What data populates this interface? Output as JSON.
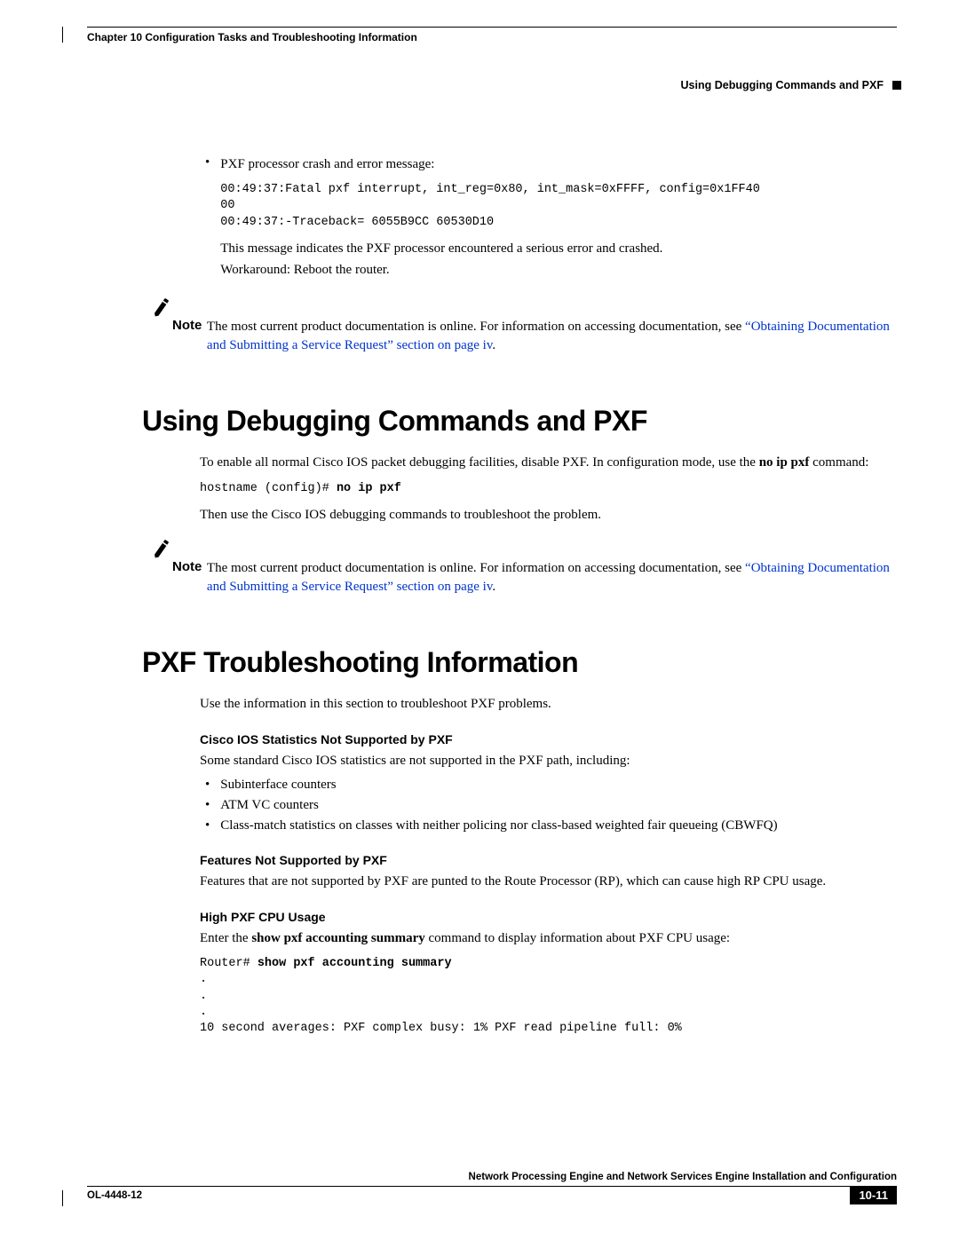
{
  "header": {
    "chapter": "Chapter 10    Configuration Tasks and Troubleshooting Information",
    "section": "Using Debugging Commands and PXF"
  },
  "bullet1": {
    "text": "PXF processor crash and error message:",
    "code": "00:49:37:Fatal pxf interrupt, int_reg=0x80, int_mask=0xFFFF, config=0x1FF40\n00\n00:49:37:-Traceback= 6055B9CC 60530D10",
    "after1": "This message indicates the PXF processor encountered a serious error and crashed.",
    "after2": "Workaround: Reboot the router."
  },
  "note_label": "Note",
  "note1": {
    "text": "The most current product documentation is online. For information on accessing documentation, see ",
    "link": "“Obtaining Documentation and Submitting a Service Request” section on page iv",
    "tail": "."
  },
  "h1a": "Using Debugging Commands and PXF",
  "sec1": {
    "p1a": "To enable all normal Cisco IOS packet debugging facilities, disable PXF. In configuration mode, use the ",
    "p1b": "no ip pxf",
    "p1c": " command:",
    "code_prefix": "hostname (config)# ",
    "code_cmd": "no ip pxf",
    "p2": "Then use the Cisco IOS debugging commands to troubleshoot the problem."
  },
  "note2": {
    "text": "The most current product documentation is online. For information on accessing documentation, see ",
    "link": "“Obtaining Documentation and Submitting a Service Request” section on page iv",
    "tail": "."
  },
  "h1b": "PXF Troubleshooting Information",
  "sec2": {
    "intro": "Use the information in this section to troubleshoot PXF problems.",
    "sub1": "Cisco IOS Statistics Not Supported by PXF",
    "sub1_p": "Some standard Cisco IOS statistics are not supported in the PXF path, including:",
    "li1": "Subinterface counters",
    "li2": "ATM VC counters",
    "li3": "Class-match statistics on classes with neither policing nor class-based weighted fair queueing (CBWFQ)",
    "sub2": "Features Not Supported by PXF",
    "sub2_p": "Features that are not supported by PXF are punted to the Route Processor (RP), which can cause high RP CPU usage.",
    "sub3": "High PXF CPU Usage",
    "sub3_p_a": "Enter the ",
    "sub3_p_b": "show pxf accounting summary",
    "sub3_p_c": " command to display information about PXF CPU usage:",
    "code2_prefix": "Router# ",
    "code2_cmd": "show pxf accounting summary",
    "code2_rest": ".\n.\n.\n10 second averages: PXF complex busy: 1% PXF read pipeline full: 0%"
  },
  "footer": {
    "title": "Network Processing Engine and Network Services Engine Installation and Configuration",
    "docnum": "OL-4448-12",
    "pagenum": "10-11"
  }
}
